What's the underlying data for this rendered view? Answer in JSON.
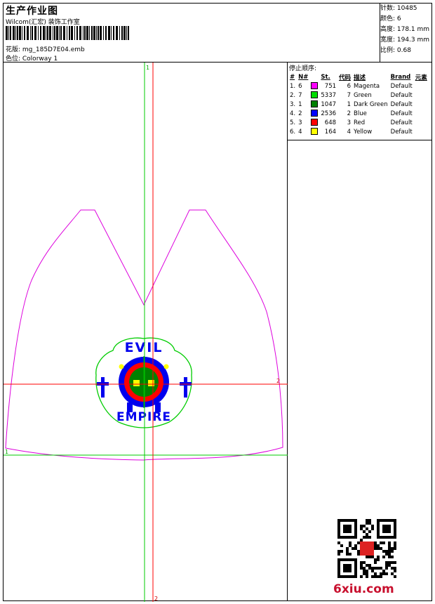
{
  "header": {
    "title": "生产作业图",
    "company": "Wilcom(汇宏) 装饰工作室",
    "design_file": "花版: mg_185D7E04.emb",
    "colorway": "色位: Colorway 1"
  },
  "stats": {
    "stitches": "针数: 10485",
    "colors": "颜色: 6",
    "height": "高度: 178.1 mm",
    "width": "宽度: 194.3 mm",
    "scale": "比例: 0.68"
  },
  "stop_sequence": {
    "title": "停止顺序:",
    "headers": [
      "#",
      "N#",
      "St.",
      "代码",
      "描述",
      "Brand",
      "元素"
    ],
    "rows": [
      {
        "idx": "1.",
        "needle": "6",
        "color": "#ff00ff",
        "stitches": "751",
        "code": "6",
        "description": "Magenta",
        "brand": "Default"
      },
      {
        "idx": "2.",
        "needle": "7",
        "color": "#00dd00",
        "stitches": "5337",
        "code": "7",
        "description": "Green",
        "brand": "Default"
      },
      {
        "idx": "3.",
        "needle": "1",
        "color": "#008000",
        "stitches": "1047",
        "code": "1",
        "description": "Dark Green",
        "brand": "Default"
      },
      {
        "idx": "4.",
        "needle": "2",
        "color": "#0000ff",
        "stitches": "2536",
        "code": "2",
        "description": "Blue",
        "brand": "Default"
      },
      {
        "idx": "5.",
        "needle": "3",
        "color": "#ff0000",
        "stitches": "648",
        "code": "3",
        "description": "Red",
        "brand": "Default"
      },
      {
        "idx": "6.",
        "needle": "4",
        "color": "#ffff00",
        "stitches": "164",
        "code": "4",
        "description": "Yellow",
        "brand": "Default"
      }
    ]
  },
  "design": {
    "text_top": "EVIL",
    "text_bottom": "EMPIRE",
    "axis_labels": {
      "v_top": "1",
      "h_right": "2",
      "h_left": "1",
      "v_bottom": "2"
    }
  },
  "watermark": "6xiu.com"
}
